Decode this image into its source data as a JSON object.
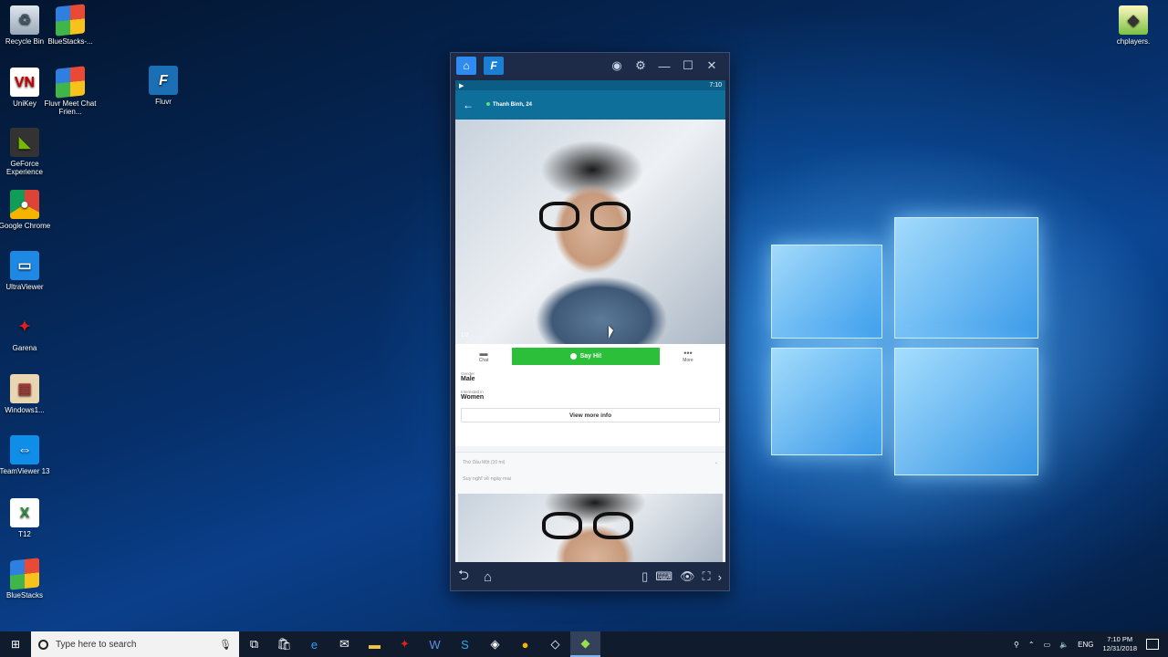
{
  "desktop": {
    "icons_left": [
      {
        "label": "Recycle Bin",
        "icon": "recycle-bin-icon"
      },
      {
        "label": "BlueStacks-...",
        "icon": "bluestacks-icon"
      },
      {
        "label": "UniKey",
        "icon": "unikey-icon"
      },
      {
        "label": "Fluvr Meet Chat Frien...",
        "icon": "bluestacks-app-icon"
      },
      {
        "label": "Fluvr",
        "icon": "fluvr-icon"
      },
      {
        "label": "GeForce Experience",
        "icon": "geforce-icon"
      },
      {
        "label": "Google Chrome",
        "icon": "chrome-icon"
      },
      {
        "label": "UltraViewer",
        "icon": "ultraviewer-icon"
      },
      {
        "label": "Garena",
        "icon": "garena-icon"
      },
      {
        "label": "Windows1...",
        "icon": "winrar-icon"
      },
      {
        "label": "TeamViewer 13",
        "icon": "teamviewer-icon"
      },
      {
        "label": "T12",
        "icon": "excel-file-icon"
      },
      {
        "label": "BlueStacks",
        "icon": "bluestacks-icon"
      }
    ],
    "icon_right": {
      "label": "chplayers.",
      "icon": "chplayers-icon"
    }
  },
  "emulator": {
    "status_time": "7:10",
    "profile": {
      "name": "Thanh Bình, 24"
    },
    "photo_counter": "1/2",
    "actions": {
      "chat": "Chat",
      "say_hi": "Say Hi!",
      "more": "More"
    },
    "info": {
      "gender_label": "Gender",
      "gender_value": "Male",
      "interested_label": "Interested in",
      "interested_value": "Women",
      "view_more": "View more info"
    },
    "post": {
      "meta": "Thứ Dầu Một (10 mi)",
      "caption": "Suy nghĩ về ngày mai"
    }
  },
  "taskbar": {
    "search_placeholder": "Type here to search",
    "language": "ENG",
    "clock_time": "7:10 PM",
    "clock_date": "12/31/2018"
  },
  "colors": {
    "say_hi_green": "#2cbf3a",
    "app_header": "#0e6f9b",
    "emulator_chrome": "#1d2a46"
  }
}
